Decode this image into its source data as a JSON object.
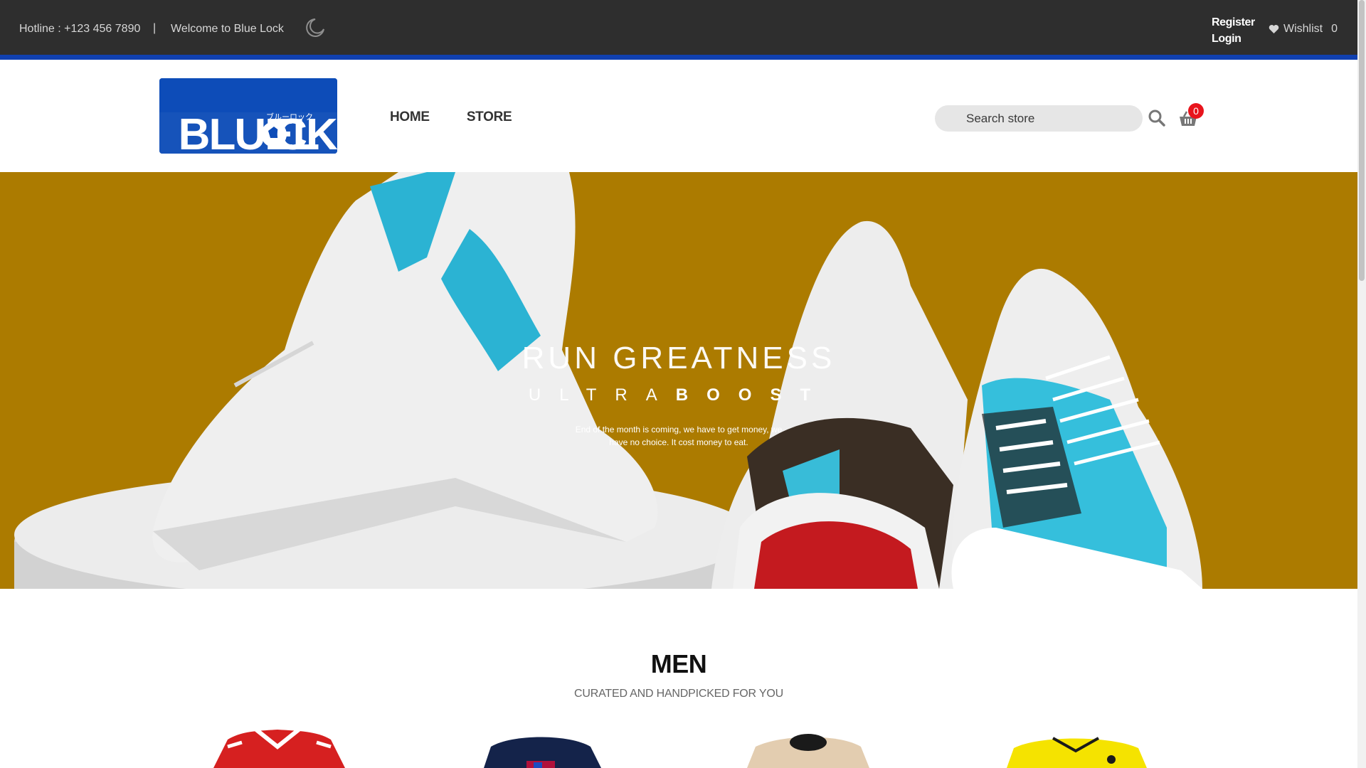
{
  "topbar": {
    "hotline": "Hotline : +123 456 7890",
    "separator": "|",
    "welcome": "Welcome to Blue Lock",
    "register": "Register",
    "login": "Login",
    "wishlist_label": "Wishlist",
    "wishlist_count": "0",
    "icons": [
      "moon-icon",
      "heart-icon"
    ]
  },
  "header": {
    "logo_text": "BLUELOCK",
    "nav": [
      "HOME",
      "STORE"
    ],
    "search_placeholder": "Search store",
    "cart_count": "0",
    "icons": [
      "search-icon",
      "cart-icon"
    ]
  },
  "hero": {
    "headline": "RUN GREATNESS",
    "sub_light": "ULTRA",
    "sub_bold": "BOOST",
    "desc_line1": "End of the month is coming, we have to get money, we",
    "desc_line2": "have no choice. It cost money to eat.",
    "colors": {
      "background": "#ac7b00"
    }
  },
  "section": {
    "title": "MEN",
    "subtitle": "CURATED AND HANDPICKED FOR YOU"
  },
  "colors": {
    "topbar": "#2e2e2e",
    "accent_blue": "#1040b0",
    "badge_red": "#e8141c"
  }
}
